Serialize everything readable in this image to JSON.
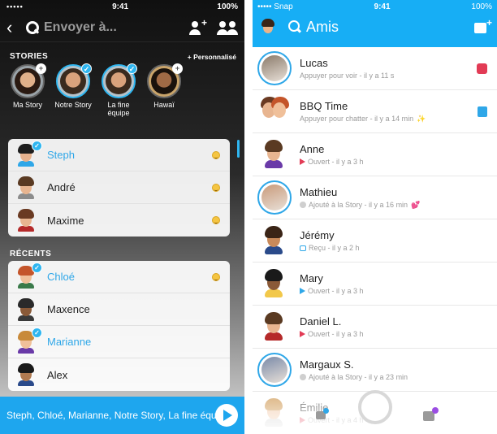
{
  "left": {
    "status": {
      "dots": "•••••",
      "time": "9:41",
      "battery": "100%"
    },
    "search": {
      "placeholder": "Envoyer à..."
    },
    "stories_section": {
      "title": "STORIES",
      "customize": "+ Personnalisé",
      "items": [
        {
          "label": "Ma Story",
          "badge": "+",
          "ring": "gray",
          "skin": "#e0b08a",
          "hair": "#2a1a12",
          "bg": "#9aa3a8"
        },
        {
          "label": "Notre Story",
          "badge": "✓",
          "ring": "blue",
          "skin": "#d9a27c",
          "hair": "#3a2a1e",
          "bg": "#b6c2c9"
        },
        {
          "label": "La fine équipe",
          "badge": "✓",
          "ring": "blue",
          "skin": "#d9a27c",
          "hair": "#3a2a1e",
          "bg": "#b6c2c9"
        },
        {
          "label": "Hawaï",
          "badge": "+",
          "ring": "gray",
          "skin": "#a06a45",
          "hair": "#1a120c",
          "bg": "#c9a46a"
        }
      ]
    },
    "best_friends": [
      {
        "name": "Steph",
        "selected": true,
        "hair": "#1e1e1e",
        "skin": "#e6b28e",
        "shirt": "#2fa7e8"
      },
      {
        "name": "André",
        "selected": false,
        "hair": "#5a3a22",
        "skin": "#e8b590",
        "shirt": "#8c8c8c"
      },
      {
        "name": "Maxime",
        "selected": false,
        "hair": "#6a3a22",
        "skin": "#e8b590",
        "shirt": "#b52a2a"
      }
    ],
    "recents_title": "RÉCENTS",
    "recents": [
      {
        "name": "Chloé",
        "selected": true,
        "hair": "#c4552a",
        "skin": "#f0c09a",
        "shirt": "#3a7a4a"
      },
      {
        "name": "Maxence",
        "selected": false,
        "hair": "#2a2a2a",
        "skin": "#8a5a38",
        "shirt": "#3a3a3a"
      },
      {
        "name": "Marianne",
        "selected": true,
        "hair": "#c88a3a",
        "skin": "#f0c09a",
        "shirt": "#6a3aa8"
      },
      {
        "name": "Alex",
        "selected": false,
        "hair": "#1a1a1a",
        "skin": "#b07a50",
        "shirt": "#2a4a8a"
      }
    ],
    "send_bar": {
      "text": "Steph, Chloé, Marianne, Notre Story, La fine équipe"
    }
  },
  "right": {
    "status": {
      "carrier": "••••• Snap",
      "time": "9:41",
      "battery": "100%"
    },
    "title": "Amis",
    "friends": [
      {
        "name": "Lucas",
        "sub": "Appuyer pour voir",
        "time": "il y a 11 s",
        "icon": "none",
        "ring": true,
        "type": "photo",
        "photo": "#8a7a6a",
        "trail": "red-square"
      },
      {
        "name": "BBQ Time",
        "sub": "Appuyer pour chatter",
        "time": "il y a 14 min",
        "icon": "none",
        "ring": false,
        "type": "group",
        "trail": "blue-chat",
        "extra": "✨"
      },
      {
        "name": "Anne",
        "sub": "Ouvert",
        "time": "il y a 3 h",
        "icon": "arrow-red",
        "ring": false,
        "type": "bitmoji",
        "hair": "#5a3a22",
        "skin": "#e8b590",
        "shirt": "#6a3aa8"
      },
      {
        "name": "Mathieu",
        "sub": "Ajouté à la Story",
        "time": "il y a 16 min",
        "icon": "story-gray",
        "ring": true,
        "type": "photo",
        "photo": "#c99a7a",
        "extra": "💕"
      },
      {
        "name": "Jérémy",
        "sub": "Reçu",
        "time": "il y a 2 h",
        "icon": "chat-blue",
        "ring": false,
        "type": "bitmoji",
        "hair": "#3a2416",
        "skin": "#c98a5a",
        "shirt": "#2a4a8a"
      },
      {
        "name": "Mary",
        "sub": "Ouvert",
        "time": "il y a 3 h",
        "icon": "arrow-blue",
        "ring": false,
        "type": "bitmoji",
        "hair": "#1a1a1a",
        "skin": "#8a5a38",
        "shirt": "#f2c84a"
      },
      {
        "name": "Daniel L.",
        "sub": "Ouvert",
        "time": "il y a 3 h",
        "icon": "arrow-red",
        "ring": false,
        "type": "bitmoji",
        "hair": "#5a3a22",
        "skin": "#e8b590",
        "shirt": "#b52a2a"
      },
      {
        "name": "Margaux S.",
        "sub": "Ajouté à la Story",
        "time": "il y a 23 min",
        "icon": "story-gray",
        "ring": true,
        "type": "photo",
        "photo": "#7a8aa8"
      },
      {
        "name": "Émilie",
        "sub": "Ouvert",
        "time": "il y a 4 h",
        "icon": "arrow-red",
        "ring": false,
        "type": "bitmoji",
        "hair": "#c88a3a",
        "skin": "#f0c09a",
        "shirt": "#d0d0d0"
      }
    ]
  }
}
